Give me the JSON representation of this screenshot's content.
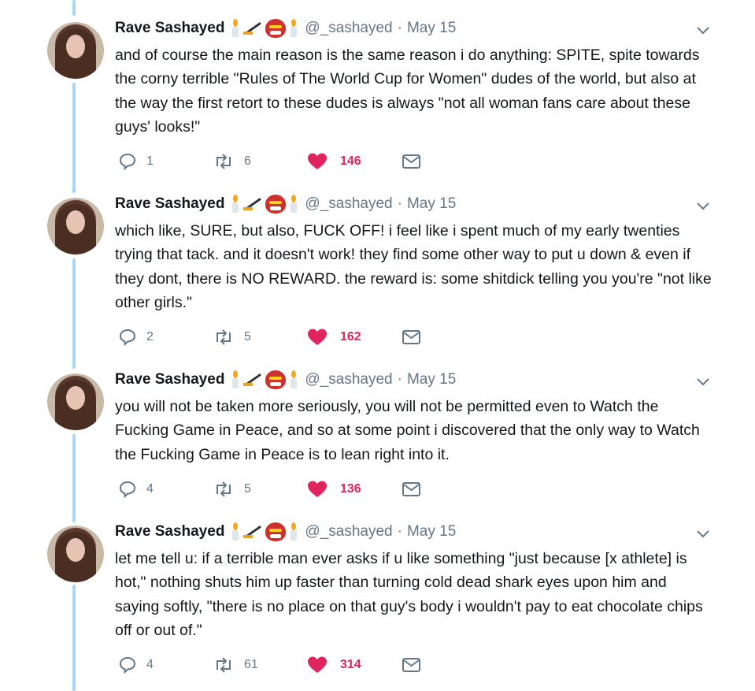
{
  "tweets": [
    {
      "name": "Rave Sashayed",
      "handle": "@_sashayed",
      "date": "May 15",
      "text": "and of course the main reason is the same reason i do anything: SPITE, spite towards the corny terrible \"Rules of The World Cup for Women\" dudes of the world, but also at the way the first retort to these dudes is always \"not all woman fans care about these guys' looks!\"",
      "replies": "1",
      "retweets": "6",
      "likes": "146"
    },
    {
      "name": "Rave Sashayed",
      "handle": "@_sashayed",
      "date": "May 15",
      "text": "which like, SURE, but also, FUCK OFF! i feel like i spent much of my early twenties trying that tack. and it doesn't work! they find some other way to put u down & even if they dont, there is NO REWARD. the reward is: some shitdick telling you you're \"not like other girls.\"",
      "replies": "2",
      "retweets": "5",
      "likes": "162"
    },
    {
      "name": "Rave Sashayed",
      "handle": "@_sashayed",
      "date": "May 15",
      "text": "you will not be taken more seriously, you will not be permitted even to Watch the Fucking Game in Peace, and so at some point i discovered that the only way to Watch the Fucking Game in Peace is to lean right into it.",
      "replies": "4",
      "retweets": "5",
      "likes": "136"
    },
    {
      "name": "Rave Sashayed",
      "handle": "@_sashayed",
      "date": "May 15",
      "text": "let me tell u: if a terrible man ever asks if u like something \"just because [x athlete] is hot,\" nothing shuts him up faster than turning cold dead shark eyes upon him and saying softly, \"there is no place on that guy's body i wouldn't pay to eat chocolate chips off or out of.\"",
      "replies": "4",
      "retweets": "61",
      "likes": "314"
    }
  ],
  "icons": {
    "name_emoji": [
      "candle-icon",
      "hockey-stick-icon",
      "oni-mask-icon",
      "candle-icon"
    ],
    "reply": "reply-icon",
    "retweet": "retweet-icon",
    "like": "heart-icon",
    "message": "envelope-icon",
    "menu": "chevron-down-icon"
  },
  "colors": {
    "thread_line": "#a9d6f5",
    "like": "#e0245e",
    "muted": "#657786",
    "text": "#14171a"
  }
}
